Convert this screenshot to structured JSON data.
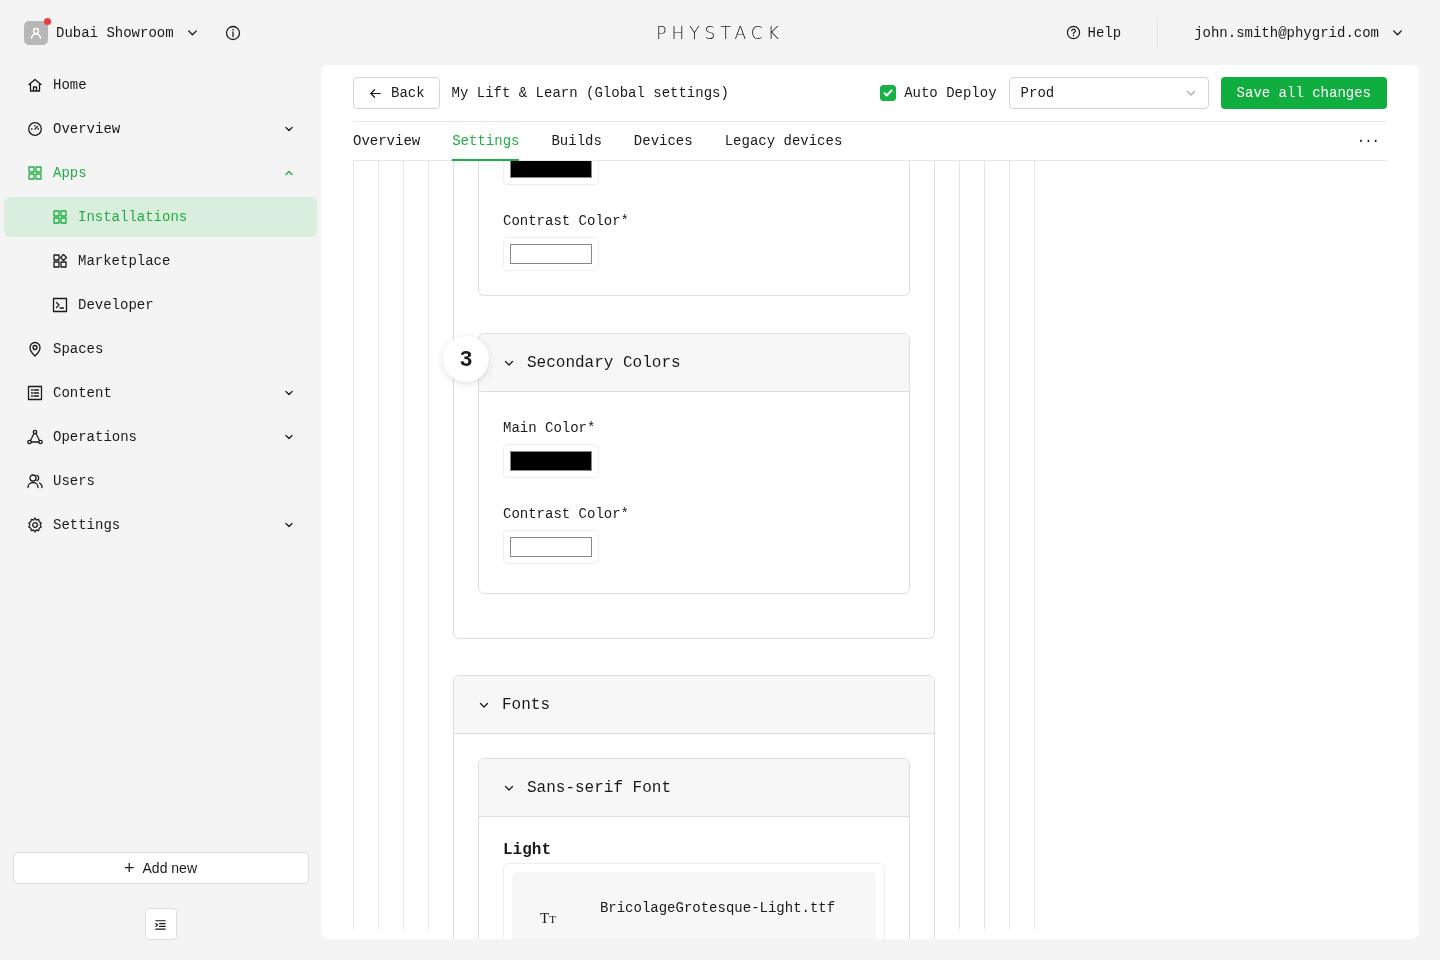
{
  "workspace": {
    "name": "Dubai Showroom",
    "notification": true
  },
  "logo": "PHYSTACK",
  "help": "Help",
  "user": "john.smith@phygrid.com",
  "nav": [
    {
      "label": "Home",
      "selected": false
    },
    {
      "label": "Overview",
      "expanded": false,
      "selected": false
    },
    {
      "label": "Apps",
      "expanded": true,
      "selected": true,
      "children": [
        {
          "label": "Installations",
          "selected": true
        },
        {
          "label": "Marketplace",
          "selected": false
        },
        {
          "label": "Developer",
          "selected": false
        }
      ]
    },
    {
      "label": "Spaces",
      "selected": false
    },
    {
      "label": "Content",
      "expanded": false,
      "selected": false
    },
    {
      "label": "Operations",
      "expanded": false,
      "selected": false
    },
    {
      "label": "Users",
      "selected": false
    },
    {
      "label": "Settings",
      "expanded": false,
      "selected": false
    }
  ],
  "add_button": {
    "icon": "+",
    "label": "Add new"
  },
  "toolbar": {
    "back": "Back",
    "title": "My Lift & Learn (Global settings)",
    "auto_deploy": {
      "label": "Auto Deploy",
      "checked": true
    },
    "environment": "Prod",
    "save": "Save all changes"
  },
  "tabs": [
    {
      "label": "Overview",
      "selected": false
    },
    {
      "label": "Settings",
      "selected": true
    },
    {
      "label": "Builds",
      "selected": false
    },
    {
      "label": "Devices",
      "selected": false
    },
    {
      "label": "Legacy devices",
      "selected": false
    }
  ],
  "more": "···",
  "primary_colors_partial": {
    "fields": [
      {
        "color": "#000000"
      },
      {
        "label": "Contrast Color*",
        "color": "#ffffff"
      }
    ]
  },
  "secondary_colors": {
    "step": "3",
    "title": "Secondary Colors",
    "fields": [
      {
        "label": "Main Color*",
        "color": "#000000"
      },
      {
        "label": "Contrast Color*",
        "color": "#ffffff"
      }
    ]
  },
  "fonts": {
    "title": "Fonts",
    "subsection": "Sans-serif Font",
    "weight": "Light",
    "file_icon": [
      "T",
      "T"
    ],
    "file": "BricolageGrotesque-Light.ttf"
  }
}
